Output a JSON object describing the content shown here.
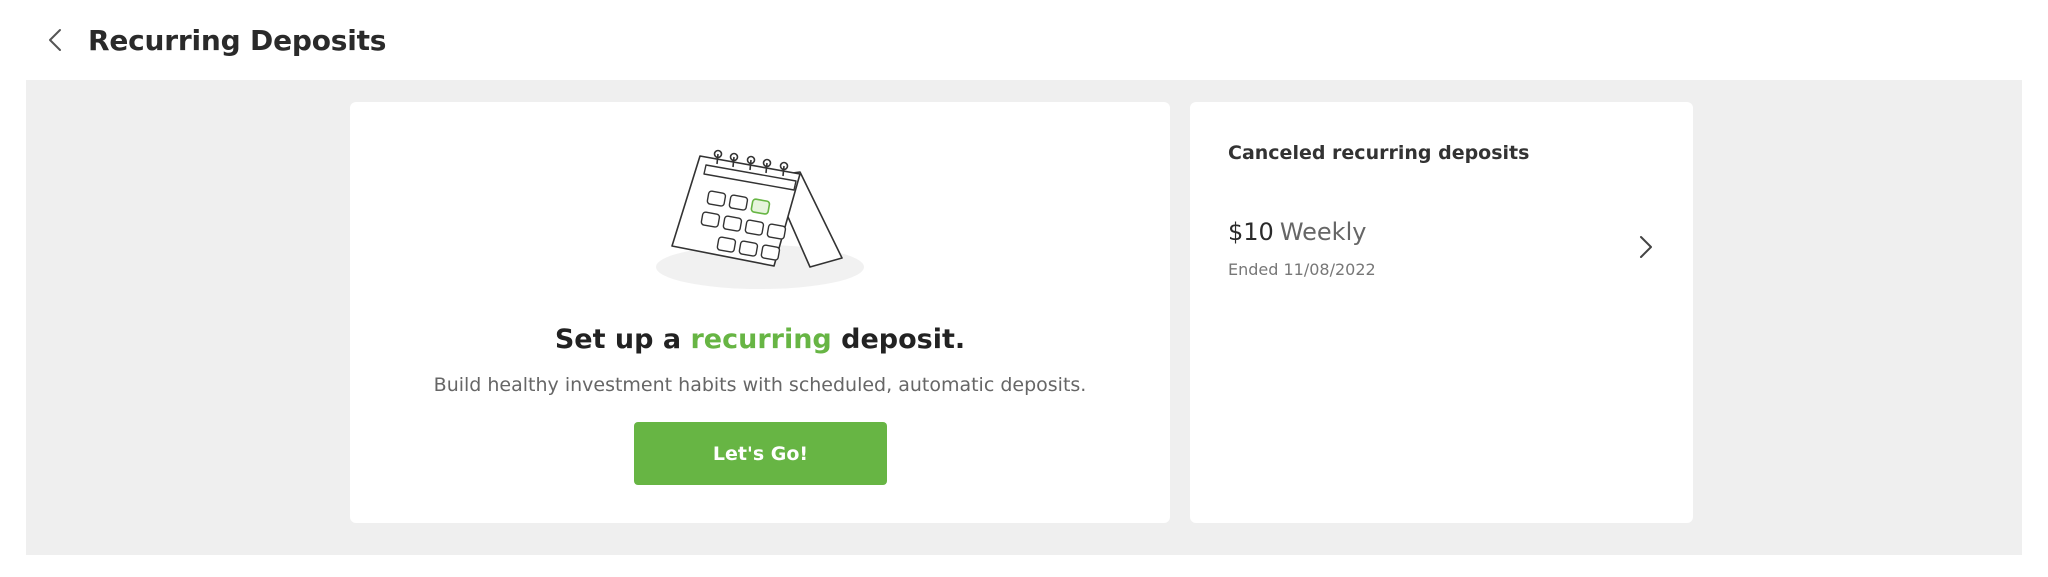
{
  "header": {
    "title": "Recurring Deposits",
    "back_icon": "chevron-left-icon"
  },
  "setup_card": {
    "illustration_icon": "calendar-icon",
    "heading_prefix": "Set up a ",
    "heading_accent": "recurring",
    "heading_suffix": " deposit.",
    "subtitle": "Build healthy investment habits with scheduled, automatic deposits.",
    "button_label": "Let's Go!"
  },
  "canceled_card": {
    "title": "Canceled recurring deposits",
    "items": [
      {
        "amount": "$10",
        "frequency": "Weekly",
        "ended": "Ended 11/08/2022",
        "icon": "chevron-right-icon"
      }
    ]
  },
  "colors": {
    "accent": "#67b544",
    "background": "#efefef",
    "card": "#ffffff",
    "text": "#2b2b2b"
  }
}
